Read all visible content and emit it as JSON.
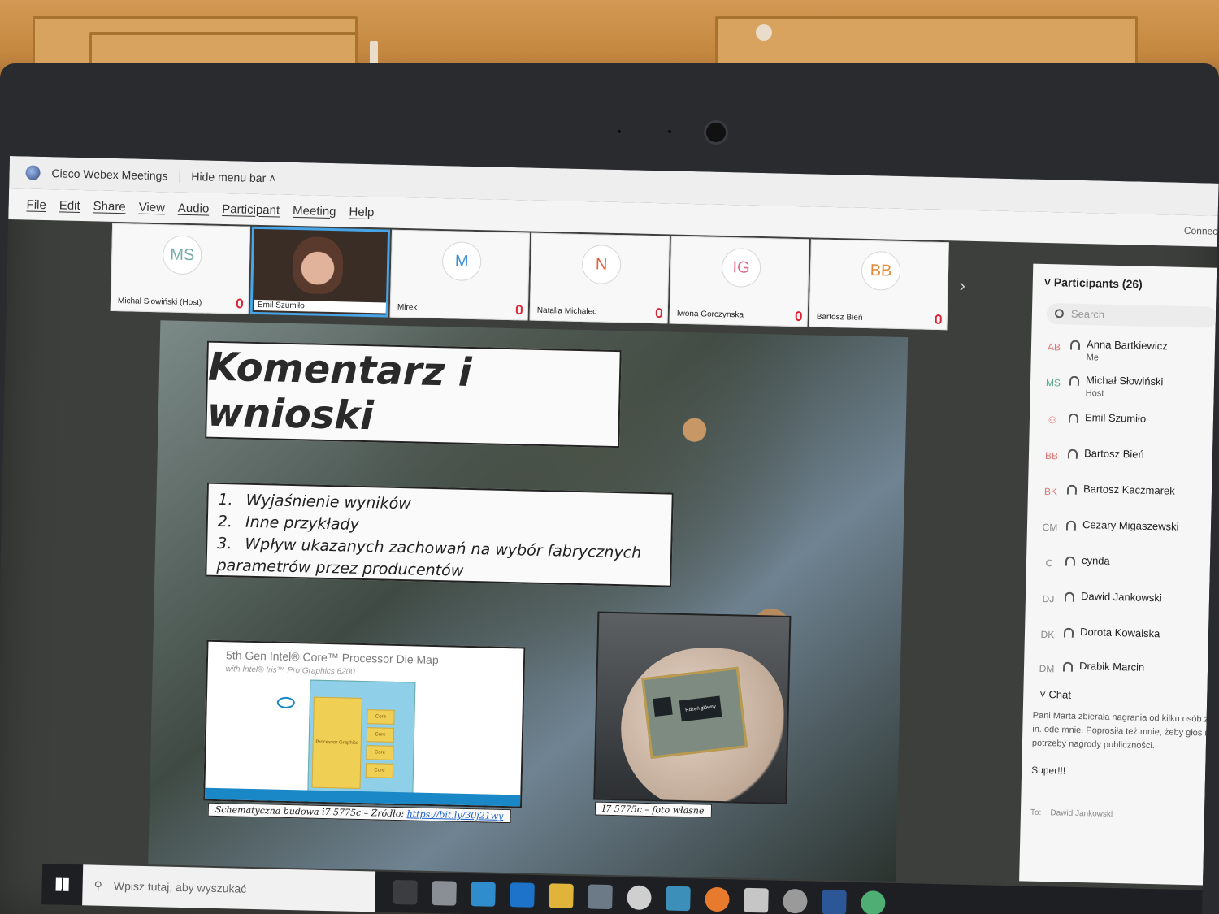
{
  "app": {
    "title": "Cisco Webex Meetings",
    "hide_menu": "Hide menu bar",
    "connect": "Connec"
  },
  "menu": [
    "File",
    "Edit",
    "Share",
    "View",
    "Audio",
    "Participant",
    "Meeting",
    "Help"
  ],
  "video_tiles": [
    {
      "initials": "MS",
      "name": "Michał Słowiński (Host)",
      "color": "#7aa"
    },
    {
      "initials": "",
      "name": "Emil Szumiło",
      "color": ""
    },
    {
      "initials": "M",
      "name": "Mirek",
      "color": "#3a8fd0"
    },
    {
      "initials": "N",
      "name": "Natalia Michalec",
      "color": "#e0603a"
    },
    {
      "initials": "IG",
      "name": "Iwona Gorczynska",
      "color": "#e06a8a"
    },
    {
      "initials": "BB",
      "name": "Bartosz Bień",
      "color": "#e08a3a"
    }
  ],
  "slide": {
    "title": "Komentarz i wnioski",
    "list": [
      {
        "num": "1.",
        "text": "Wyjaśnienie wyników"
      },
      {
        "num": "2.",
        "text": "Inne przykłady"
      },
      {
        "num": "3.",
        "text": "Wpływ ukazanych zachowań na wybór fabrycznych parametrów przez producentów"
      }
    ],
    "die_heading": "5th Gen Intel® Core™ Processor Die Map",
    "die_sub": "with Intel® Iris™ Pro Graphics 6200",
    "die_labels": [
      "Processor Graphics",
      "Core",
      "Core",
      "Core",
      "Core"
    ],
    "caption_left": "Schematyczna budowa i7 5775c – Źródło: ",
    "caption_link": "https://bit.ly/30j21wy",
    "caption_right": "I7 5775c – foto własne",
    "cpu_label": "Rdzeń główny"
  },
  "participants": {
    "header": "Participants (26)",
    "search_placeholder": "Search",
    "list": [
      {
        "initials": "AB",
        "name": "Anna Bartkiewicz",
        "role": "Me"
      },
      {
        "initials": "MS",
        "name": "Michał Słowiński",
        "role": "Host"
      },
      {
        "initials": "",
        "name": "Emil Szumiło",
        "role": ""
      },
      {
        "initials": "BB",
        "name": "Bartosz Bień",
        "role": ""
      },
      {
        "initials": "BK",
        "name": "Bartosz Kaczmarek",
        "role": ""
      },
      {
        "initials": "CM",
        "name": "Cezary Migaszewski",
        "role": ""
      },
      {
        "initials": "C",
        "name": "cynda",
        "role": ""
      },
      {
        "initials": "DJ",
        "name": "Dawid Jankowski",
        "role": ""
      },
      {
        "initials": "DK",
        "name": "Dorota Kowalska",
        "role": ""
      },
      {
        "initials": "DM",
        "name": "Drabik Marcin",
        "role": ""
      }
    ]
  },
  "chat": {
    "header": "Chat",
    "message": "Pani Marta zbierała nagrania od kilku osób z IF, m. in. ode mnie. Poprosiła też mnie, żeby głos na potrzeby nagrody publiczności.",
    "reply": "Super!!!",
    "to_label": "To:",
    "to_value": "Dawid Jankowski"
  },
  "taskbar": {
    "search_placeholder": "Wpisz tutaj, aby wyszukać"
  }
}
